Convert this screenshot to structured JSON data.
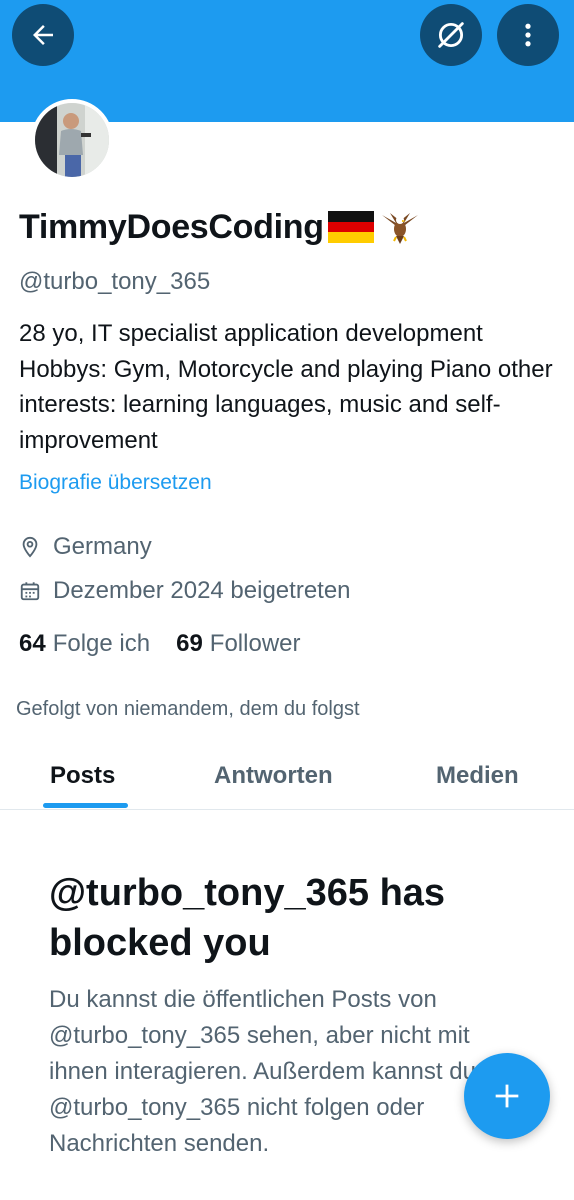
{
  "header": {
    "back_icon": "arrow-left-icon",
    "noview_icon": "eye-slash-circle-icon",
    "more_icon": "more-vertical-icon",
    "banner_color": "#1d9bf0",
    "button_color": "#0f4c75"
  },
  "profile": {
    "display_name": "TimmyDoesCoding",
    "handle": "@turbo_tony_365",
    "bio": "28 yo, IT specialist application development Hobbys: Gym, Motorcycle and playing Piano other interests: learning languages, music and self-improvement",
    "translate_link": "Biografie übersetzen",
    "location": "Germany",
    "joined": "Dezember 2024 beigetreten",
    "following_count": "64",
    "following_label": "Folge ich",
    "followers_count": "69",
    "followers_label": "Follower",
    "followed_by": "Gefolgt von niemandem, dem du folgst"
  },
  "tabs": [
    {
      "label": "Posts",
      "active": true
    },
    {
      "label": "Antworten",
      "active": false
    },
    {
      "label": "Medien",
      "active": false
    }
  ],
  "blocked": {
    "title": "@turbo_tony_365 has blocked you",
    "message": "Du kannst die öffentlichen Posts von @turbo_tony_365 sehen, aber nicht mit ihnen interagieren. Außerdem kannst du @turbo_tony_365 nicht folgen oder Nachrichten senden."
  },
  "fab": {
    "icon": "plus-icon"
  },
  "colors": {
    "accent": "#1d9bf0",
    "text": "#0f1419",
    "muted": "#536471"
  }
}
